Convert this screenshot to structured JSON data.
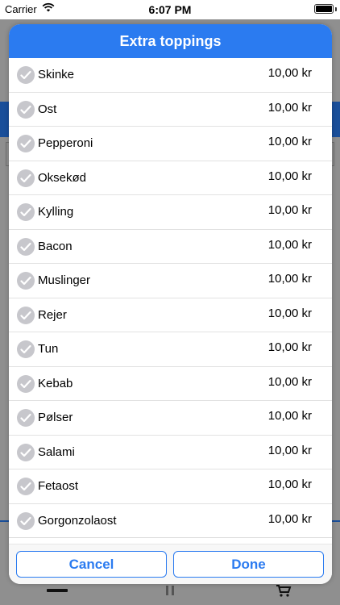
{
  "status_bar": {
    "carrier": "Carrier",
    "time": "6:07 PM"
  },
  "modal": {
    "title": "Extra toppings",
    "items": [
      {
        "name": "Skinke",
        "price": "10,00 kr"
      },
      {
        "name": "Ost",
        "price": "10,00 kr"
      },
      {
        "name": "Pepperoni",
        "price": "10,00 kr"
      },
      {
        "name": "Oksekød",
        "price": "10,00 kr"
      },
      {
        "name": "Kylling",
        "price": "10,00 kr"
      },
      {
        "name": "Bacon",
        "price": "10,00 kr"
      },
      {
        "name": "Muslinger",
        "price": "10,00 kr"
      },
      {
        "name": "Rejer",
        "price": "10,00 kr"
      },
      {
        "name": "Tun",
        "price": "10,00 kr"
      },
      {
        "name": "Kebab",
        "price": "10,00 kr"
      },
      {
        "name": "Pølser",
        "price": "10,00 kr"
      },
      {
        "name": "Salami",
        "price": "10,00 kr"
      },
      {
        "name": "Fetaost",
        "price": "10,00 kr"
      },
      {
        "name": "Gorgonzolaost",
        "price": "10,00 kr"
      }
    ],
    "cancel_label": "Cancel",
    "done_label": "Done"
  },
  "icons": {
    "check": "checkmark-circle-icon",
    "wifi": "wifi-icon",
    "battery": "battery-icon"
  },
  "colors": {
    "accent": "#2b7bf0",
    "check_gray": "#c7c7cc"
  }
}
